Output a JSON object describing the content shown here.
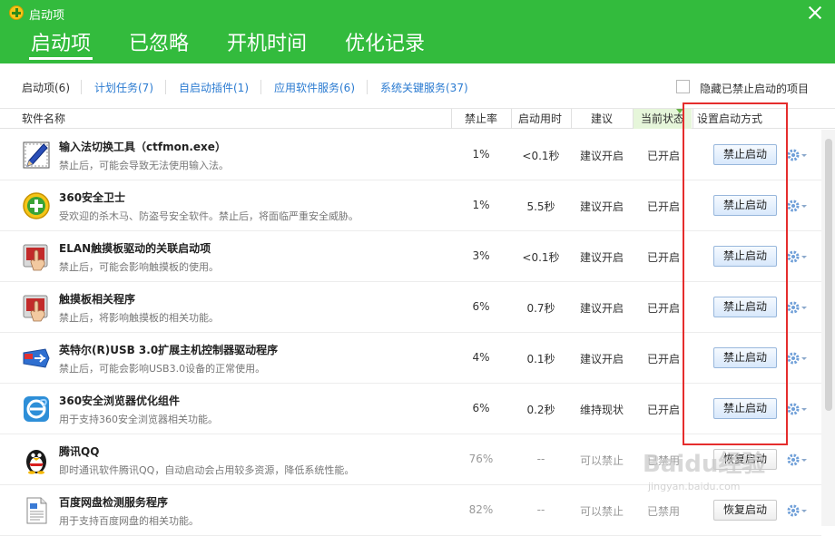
{
  "window": {
    "title": "启动项"
  },
  "main_tabs": [
    {
      "label": "启动项",
      "active": true
    },
    {
      "label": "已忽略",
      "active": false
    },
    {
      "label": "开机时间",
      "active": false
    },
    {
      "label": "优化记录",
      "active": false
    }
  ],
  "sub_tabs": [
    {
      "label": "启动项(6)",
      "active": true
    },
    {
      "label": "计划任务(7)",
      "active": false
    },
    {
      "label": "自启动插件(1)",
      "active": false
    },
    {
      "label": "应用软件服务(6)",
      "active": false
    },
    {
      "label": "系统关键服务(37)",
      "active": false
    }
  ],
  "hide_disabled": {
    "label": "隐藏已禁止启动的项目",
    "checked": false
  },
  "columns": {
    "name": "软件名称",
    "rate": "禁止率",
    "time": "启动用时",
    "suggestion": "建议",
    "status": "当前状态",
    "action": "设置启动方式"
  },
  "rows": [
    {
      "icon": "pen-icon",
      "name": "输入法切换工具（ctfmon.exe）",
      "desc": "禁止后，可能会导致无法使用输入法。",
      "rate": "1%",
      "time": "<0.1秒",
      "suggestion": "建议开启",
      "status": "已开启",
      "action": "禁止启动",
      "disabled": false
    },
    {
      "icon": "360-safe-icon",
      "name": "360安全卫士",
      "desc": "受欢迎的杀木马、防盗号安全软件。禁止后，将面临严重安全威胁。",
      "rate": "1%",
      "time": "5.5秒",
      "suggestion": "建议开启",
      "status": "已开启",
      "action": "禁止启动",
      "disabled": false
    },
    {
      "icon": "touchpad-icon",
      "name": "ELAN触摸板驱动的关联启动项",
      "desc": "禁止后，可能会影响触摸板的使用。",
      "rate": "3%",
      "time": "<0.1秒",
      "suggestion": "建议开启",
      "status": "已开启",
      "action": "禁止启动",
      "disabled": false
    },
    {
      "icon": "touchpad-icon",
      "name": "触摸板相关程序",
      "desc": "禁止后，将影响触摸板的相关功能。",
      "rate": "6%",
      "time": "0.7秒",
      "suggestion": "建议开启",
      "status": "已开启",
      "action": "禁止启动",
      "disabled": false
    },
    {
      "icon": "usb-icon",
      "name": "英特尔(R)USB 3.0扩展主机控制器驱动程序",
      "desc": "禁止后，可能会影响USB3.0设备的正常使用。",
      "rate": "4%",
      "time": "0.1秒",
      "suggestion": "建议开启",
      "status": "已开启",
      "action": "禁止启动",
      "disabled": false
    },
    {
      "icon": "browser-icon",
      "name": "360安全浏览器优化组件",
      "desc": "用于支持360安全浏览器相关功能。",
      "rate": "6%",
      "time": "0.2秒",
      "suggestion": "维持现状",
      "status": "已开启",
      "action": "禁止启动",
      "disabled": false
    },
    {
      "icon": "qq-penguin-icon",
      "name": "腾讯QQ",
      "desc": "即时通讯软件腾讯QQ，自动启动会占用较多资源，降低系统性能。",
      "rate": "76%",
      "time": "--",
      "suggestion": "可以禁止",
      "status": "已禁用",
      "action": "恢复启动",
      "disabled": true
    },
    {
      "icon": "document-icon",
      "name": "百度网盘检测服务程序",
      "desc": "用于支持百度网盘的相关功能。",
      "rate": "82%",
      "time": "--",
      "suggestion": "可以禁止",
      "status": "已禁用",
      "action": "恢复启动",
      "disabled": true
    }
  ],
  "watermark": {
    "text": "Baidu经验",
    "sub": "jingyan.baidu.com"
  },
  "colors": {
    "header_green": "#33bb3d",
    "link_blue": "#2b7bd1",
    "highlight_red": "#e52d2d"
  }
}
